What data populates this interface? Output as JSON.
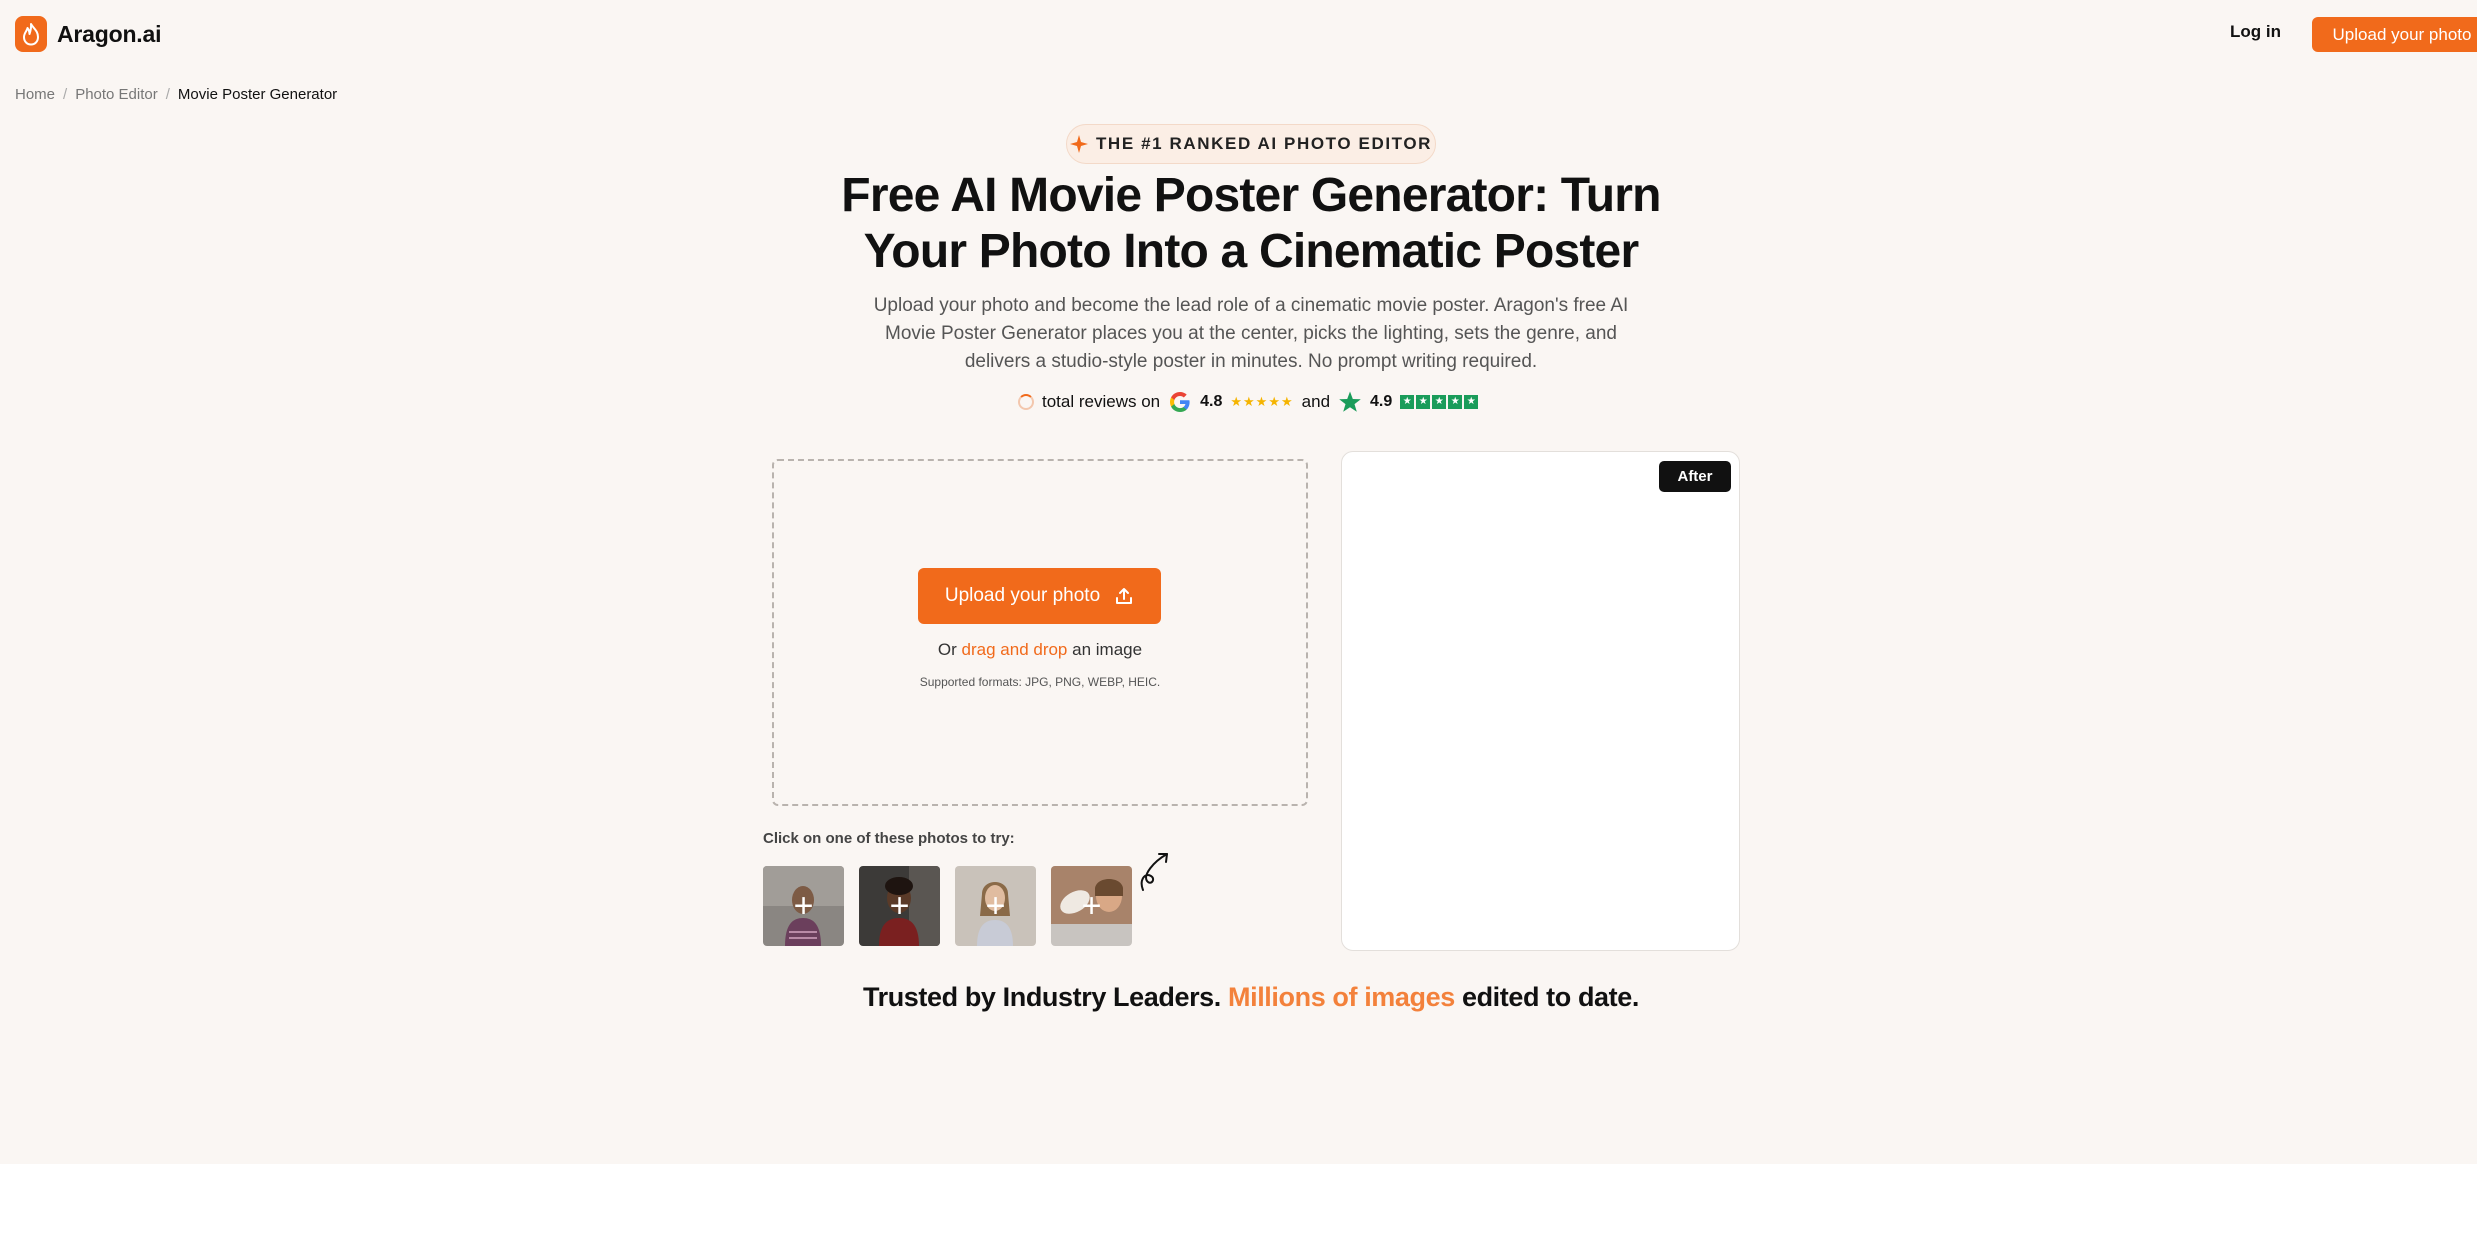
{
  "header": {
    "logo_text": "Aragon.ai",
    "login_label": "Log in",
    "upload_label": "Upload your photo"
  },
  "breadcrumb": {
    "items": [
      "Home",
      "Photo Editor",
      "Movie Poster Generator"
    ],
    "separator": "/"
  },
  "hero": {
    "badge": "THE #1 RANKED AI PHOTO EDITOR",
    "title": "Free AI Movie Poster Generator: Turn Your Photo Into a Cinematic Poster",
    "subtitle": "Upload your photo and become the lead role of a cinematic movie poster. Aragon's free AI Movie Poster Generator places you at the center, picks the lighting, sets the genre, and delivers a studio-style poster in minutes. No prompt writing required.",
    "reviews": {
      "prefix": "total reviews on",
      "google_score": "4.8",
      "joiner": "and",
      "trustpilot_score": "4.9"
    }
  },
  "upload": {
    "button_label": "Upload your photo",
    "or_text": "Or",
    "drag_text": "drag and drop",
    "an_image_text": "an image",
    "formats": "Supported formats: JPG, PNG, WEBP, HEIC."
  },
  "samples": {
    "label": "Click on one of these photos to try:",
    "plus": "+"
  },
  "preview": {
    "after_label": "After"
  },
  "trusted": {
    "lead": "Trusted by Industry Leaders.",
    "highlight": "Millions of images",
    "tail": "edited to date."
  },
  "colors": {
    "brand": "#f16a1b",
    "background": "#faf6f3",
    "highlight": "#f3813b",
    "google_star": "#f5b400",
    "trustpilot": "#1a9c5a"
  }
}
